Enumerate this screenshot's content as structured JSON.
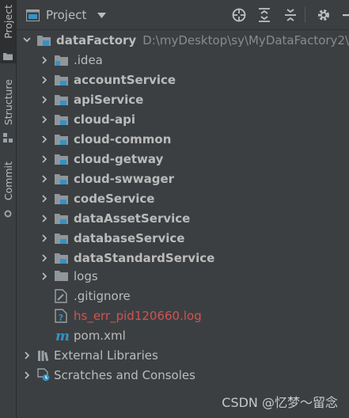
{
  "stripe": {
    "project_label": "Project",
    "structure_label": "Structure",
    "commit_label": "Commit"
  },
  "toolbar": {
    "title": "Project"
  },
  "tree": {
    "root": {
      "name": "dataFactory",
      "path": "D:\\myDesktop\\sy\\MyDataFactory2\\dat"
    },
    "modules": [
      {
        "name": ".idea",
        "bold": false
      },
      {
        "name": "accountService",
        "bold": true
      },
      {
        "name": "apiService",
        "bold": true
      },
      {
        "name": "cloud-api",
        "bold": true
      },
      {
        "name": "cloud-common",
        "bold": true
      },
      {
        "name": "cloud-getway",
        "bold": true
      },
      {
        "name": "cloud-swwager",
        "bold": true
      },
      {
        "name": "codeService",
        "bold": true
      },
      {
        "name": "dataAssetService",
        "bold": true
      },
      {
        "name": "databaseService",
        "bold": true
      },
      {
        "name": "dataStandardService",
        "bold": true
      }
    ],
    "logs": "logs",
    "files": [
      {
        "name": ".gitignore"
      },
      {
        "name": "hs_err_pid120660.log"
      },
      {
        "name": "pom.xml"
      }
    ],
    "external_libraries": "External Libraries",
    "scratches": "Scratches and Consoles"
  },
  "colors": {
    "background": "#3c3f41",
    "text": "#bbbbbb",
    "error_text": "#d05454",
    "module_badge": "#3592c4",
    "folder": "#8f979c"
  },
  "watermark": "CSDN @忆梦～留念"
}
